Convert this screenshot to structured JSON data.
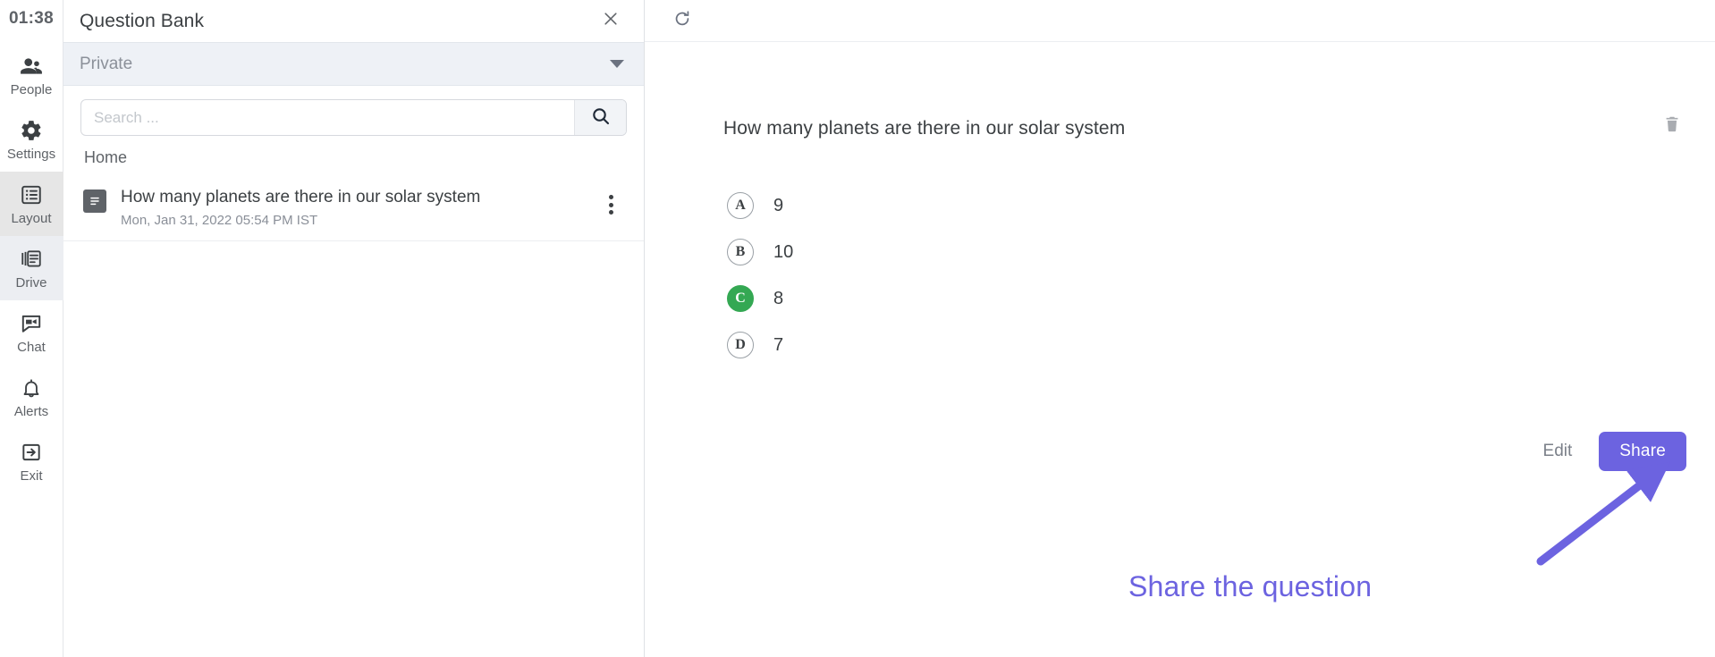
{
  "rail": {
    "clock": "01:38",
    "items": [
      {
        "label": "People",
        "icon": "people-icon",
        "state": "default"
      },
      {
        "label": "Settings",
        "icon": "gear-icon",
        "state": "default"
      },
      {
        "label": "Layout",
        "icon": "layout-icon",
        "state": "active"
      },
      {
        "label": "Drive",
        "icon": "drive-icon",
        "state": "active-soft"
      },
      {
        "label": "Chat",
        "icon": "chat-icon",
        "state": "default"
      },
      {
        "label": "Alerts",
        "icon": "bell-icon",
        "state": "default"
      },
      {
        "label": "Exit",
        "icon": "exit-icon",
        "state": "default"
      }
    ]
  },
  "question_bank": {
    "title": "Question Bank",
    "close_icon": "close-icon",
    "scope": {
      "selected": "Private",
      "options": [
        "Private"
      ]
    },
    "search": {
      "placeholder": "Search ...",
      "value": "",
      "button_icon": "search-icon"
    },
    "breadcrumb": "Home",
    "items": [
      {
        "title": "How many planets are there in our solar system",
        "date": "Mon, Jan 31, 2022 05:54 PM IST",
        "icon": "document-icon",
        "menu_icon": "kebab-menu-icon"
      }
    ]
  },
  "main": {
    "toolbar": {
      "refresh_icon": "refresh-icon"
    },
    "delete_icon": "trash-icon",
    "question": "How many planets are there in our solar system",
    "options": [
      {
        "letter": "A",
        "text": "9",
        "correct": false
      },
      {
        "letter": "B",
        "text": "10",
        "correct": false
      },
      {
        "letter": "C",
        "text": "8",
        "correct": true
      },
      {
        "letter": "D",
        "text": "7",
        "correct": false
      }
    ],
    "edit_label": "Edit",
    "share_label": "Share"
  },
  "annotation": {
    "text": "Share the question",
    "color": "#6c63e0"
  },
  "colors": {
    "accent": "#6c63e0",
    "correct": "#34a853",
    "panel_header": "#eef1f6",
    "text": "#3c4043",
    "muted": "#8a8f98"
  }
}
